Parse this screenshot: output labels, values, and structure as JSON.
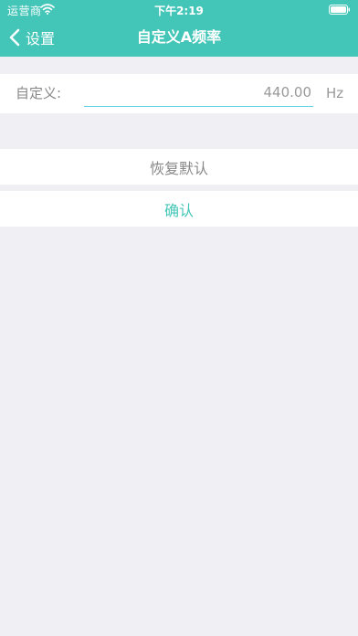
{
  "status_bar": {
    "carrier": "运营商",
    "time": "下午2:19"
  },
  "nav": {
    "back_label": "设置",
    "title": "自定义A频率"
  },
  "form": {
    "label": "自定义:",
    "value": "440.00",
    "unit": "Hz"
  },
  "actions": {
    "reset_label": "恢复默认",
    "confirm_label": "确认"
  },
  "colors": {
    "accent": "#43c6b8",
    "background": "#efeff4",
    "input_underline": "#5fd3e6"
  }
}
